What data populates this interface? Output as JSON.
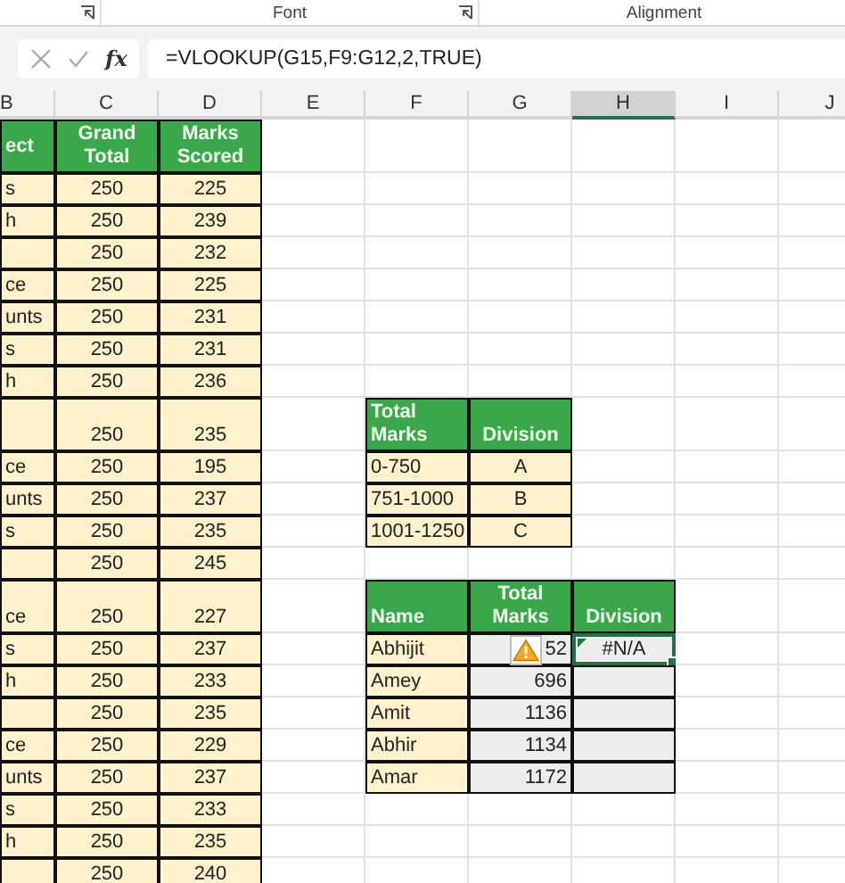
{
  "ribbon": {
    "groups": [
      {
        "label": "Font"
      },
      {
        "label": "Alignment"
      }
    ]
  },
  "formula_bar": {
    "function_button": "fx",
    "formula": "=VLOOKUP(G15,F9:G12,2,TRUE)"
  },
  "columns": [
    {
      "label": "B",
      "selected": false
    },
    {
      "label": "C",
      "selected": false
    },
    {
      "label": "D",
      "selected": false
    },
    {
      "label": "E",
      "selected": false
    },
    {
      "label": "F",
      "selected": false
    },
    {
      "label": "G",
      "selected": false
    },
    {
      "label": "H",
      "selected": true
    },
    {
      "label": "I",
      "selected": false
    },
    {
      "label": "J",
      "selected": false
    }
  ],
  "marks_table": {
    "headers": [
      "ect",
      "Grand Total",
      "Marks Scored"
    ],
    "rows": [
      {
        "subject": "s",
        "grand_total": "250",
        "marks_scored": "225"
      },
      {
        "subject": "h",
        "grand_total": "250",
        "marks_scored": "239"
      },
      {
        "grand_total": "250",
        "marks_scored": "232"
      },
      {
        "subject": "ce",
        "grand_total": "250",
        "marks_scored": "225"
      },
      {
        "subject": "unts",
        "grand_total": "250",
        "marks_scored": "231"
      },
      {
        "subject": "s",
        "grand_total": "250",
        "marks_scored": "231"
      },
      {
        "subject": "h",
        "grand_total": "250",
        "marks_scored": "236"
      },
      {
        "grand_total": "250",
        "marks_scored": "235"
      },
      {
        "subject": "ce",
        "grand_total": "250",
        "marks_scored": "195"
      },
      {
        "subject": "unts",
        "grand_total": "250",
        "marks_scored": "237"
      },
      {
        "subject": "s",
        "grand_total": "250",
        "marks_scored": "235"
      },
      {
        "grand_total": "250",
        "marks_scored": "245"
      },
      {
        "subject": "ce",
        "grand_total": "250",
        "marks_scored": "227"
      },
      {
        "subject": "s",
        "grand_total": "250",
        "marks_scored": "237"
      },
      {
        "subject": "h",
        "grand_total": "250",
        "marks_scored": "233"
      },
      {
        "grand_total": "250",
        "marks_scored": "235"
      },
      {
        "subject": "ce",
        "grand_total": "250",
        "marks_scored": "229"
      },
      {
        "subject": "unts",
        "grand_total": "250",
        "marks_scored": "237"
      },
      {
        "subject": "s",
        "grand_total": "250",
        "marks_scored": "233"
      },
      {
        "subject": "h",
        "grand_total": "250",
        "marks_scored": "235"
      },
      {
        "grand_total": "250",
        "marks_scored": "240"
      }
    ]
  },
  "division_table": {
    "headers": [
      "Total Marks",
      "Division"
    ],
    "rows": [
      {
        "total_marks": "0-750",
        "division": "A"
      },
      {
        "total_marks": "751-1000",
        "division": "B"
      },
      {
        "total_marks": "1001-1250",
        "division": "C"
      }
    ]
  },
  "lookup_table": {
    "headers": [
      "Name",
      "Total Marks",
      "Division"
    ],
    "rows": [
      {
        "name": "Abhijit",
        "total_marks": "52",
        "division": "#N/A",
        "selected": true,
        "warning": true
      },
      {
        "name": "Amey",
        "total_marks": "696",
        "selected": false,
        "warning": false
      },
      {
        "name": "Amit",
        "total_marks": "1136",
        "selected": false,
        "warning": false
      },
      {
        "name": "Abhir",
        "total_marks": "1134",
        "selected": false,
        "warning": false
      },
      {
        "name": "Amar",
        "total_marks": "1172",
        "selected": false,
        "warning": false
      }
    ]
  }
}
